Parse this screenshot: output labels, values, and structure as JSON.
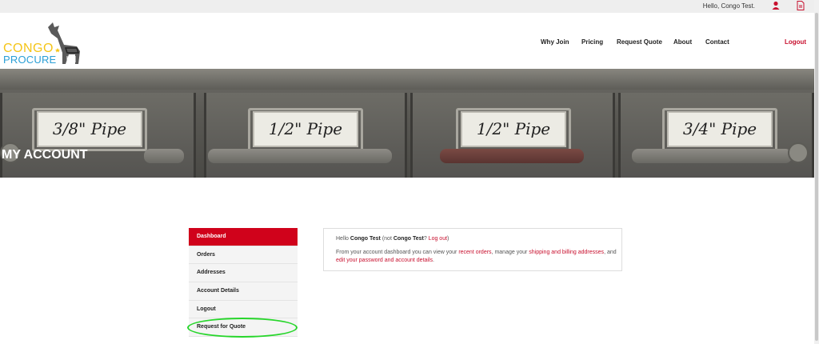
{
  "topbar": {
    "greeting": "Hello, Congo Test."
  },
  "logo": {
    "line1": "CONGO",
    "line2": "PROCURE"
  },
  "nav": {
    "items": [
      "Why Join",
      "Pricing",
      "Request Quote",
      "About",
      "Contact"
    ],
    "logout": "Logout"
  },
  "hero": {
    "title": "MY ACCOUNT",
    "cards": [
      "3/8\" Pipe",
      "1/2\" Pipe",
      "1/2\" Pipe",
      "3/4\" Pipe"
    ]
  },
  "sidebar": {
    "items": [
      {
        "label": "Dashboard",
        "active": true
      },
      {
        "label": "Orders"
      },
      {
        "label": "Addresses"
      },
      {
        "label": "Account Details"
      },
      {
        "label": "Logout"
      },
      {
        "label": "Request for Quote"
      }
    ]
  },
  "dashboard": {
    "hello_prefix": "Hello ",
    "user_name": "Congo Test",
    "not_prefix": " (not ",
    "not_name": "Congo Test",
    "not_suffix": "? ",
    "logout_link": "Log out",
    "close_paren": ")",
    "desc_1": "From your account dashboard you can view your ",
    "recent_orders_link": "recent orders",
    "desc_2": ", manage your ",
    "addresses_link": "shipping and billing addresses",
    "desc_3": ", and",
    "password_link": "edit your password and account details",
    "desc_4": "."
  },
  "colors": {
    "accent": "#d0021b",
    "highlight": "#27d62b",
    "link": "#c8102e"
  }
}
